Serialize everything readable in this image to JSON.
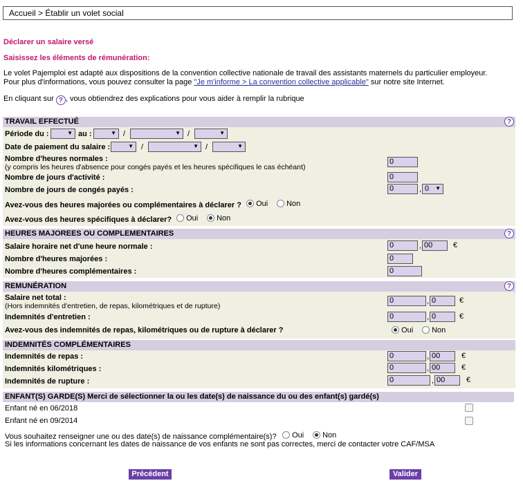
{
  "breadcrumb": "Accueil > Établir un volet social",
  "page_title": "Déclarer un salaire versé",
  "page_subtitle": "Saisissez les éléments de rémunération:",
  "intro": {
    "line1": "Le volet Pajemploi est adapté aux dispositions de la convention collective nationale de travail des assistants maternels du particulier employeur.",
    "line2_pre": "Pour plus d'informations, vous pouvez consulter la page ",
    "line2_link": "\"Je m'informe > La convention collective applicable\"",
    "line2_post": " sur notre site Internet.",
    "help_pre": "En cliquant sur ",
    "help_post": ", vous obtiendrez des explications pour vous aider à remplir la rubrique"
  },
  "help_icon_glyph": "?",
  "sections": {
    "travail": {
      "title": "TRAVAIL EFFECTUÉ",
      "periode_label": "Période du :",
      "au_label": "au :",
      "slash": "/",
      "paiement_label": "Date de paiement du salaire :",
      "heures_label": "Nombre d'heures normales :",
      "heures_sub": "(y compris les heures d'absence pour congés payés et les heures spécifiques le cas échéant)",
      "heures_value": "0",
      "jours_activite_label": "Nombre de jours d'activité :",
      "jours_activite_value": "0",
      "conges_label": "Nombre de jours de congés payés :",
      "conges_value": "0",
      "conges_comma": ",",
      "conges_decimal": "0",
      "majorees_question": "Avez-vous des heures majorées ou complémentaires à déclarer ?",
      "specifiques_question": "Avez-vous des heures spécifiques à déclarer?",
      "oui": "Oui",
      "non": "Non"
    },
    "heures_majorees": {
      "title": "HEURES MAJOREES OU COMPLEMENTAIRES",
      "salaire_horaire_label": "Salaire horaire net d'une heure normale :",
      "salaire_horaire_value": "0",
      "salaire_horaire_decimal": "00",
      "nb_majorees_label": "Nombre d'heures majorées :",
      "nb_majorees_value": "0",
      "nb_complementaires_label": "Nombre d'heures complémentaires :",
      "nb_complementaires_value": "0"
    },
    "remuneration": {
      "title": "REMUNÉRATION",
      "salaire_total_label": "Salaire net total :",
      "salaire_total_sub": "(Hors indemnités d'entretien, de repas, kilométriques et de rupture)",
      "salaire_total_value": "0",
      "salaire_total_decimal": "0",
      "entretien_label": "Indemnités d'entretien :",
      "entretien_value": "0",
      "entretien_decimal": "0",
      "indemnites_question": "Avez-vous des indemnités de repas, kilométriques ou de rupture à déclarer ?",
      "oui": "Oui",
      "non": "Non"
    },
    "indemnites": {
      "title": "INDEMNITÉS COMPLÉMENTAIRES",
      "repas_label": "Indemnités de repas :",
      "repas_value": "0",
      "repas_decimal": "00",
      "km_label": "Indemnités kilométriques :",
      "km_value": "0",
      "km_decimal": "00",
      "rupture_label": "Indemnités de rupture :",
      "rupture_value": "0",
      "rupture_decimal": "00"
    },
    "enfants": {
      "title": "ENFANT(S) GARDE(S) Merci de sélectionner la ou les date(s) de naissance du ou des enfant(s) gardé(s)",
      "child1": "Enfant né en 06/2018",
      "child2": "Enfant né en 09/2014",
      "complementaires_question": "Vous souhaitez renseigner une ou des date(s) de naissance complémentaire(s)?",
      "oui": "Oui",
      "non": "Non",
      "note": "Si les informations concernant les dates de naissance de vos enfants ne sont pas correctes, merci de contacter votre CAF/MSA"
    }
  },
  "currency": "€",
  "comma": ",",
  "buttons": {
    "previous": "Précédent",
    "validate": "Valider"
  },
  "colors": {
    "accent": "#6a3fa8",
    "title_pink": "#c0186f",
    "section_header": "#d5cde0",
    "section_body": "#efefe2",
    "input_bg": "#d9d2ea"
  }
}
